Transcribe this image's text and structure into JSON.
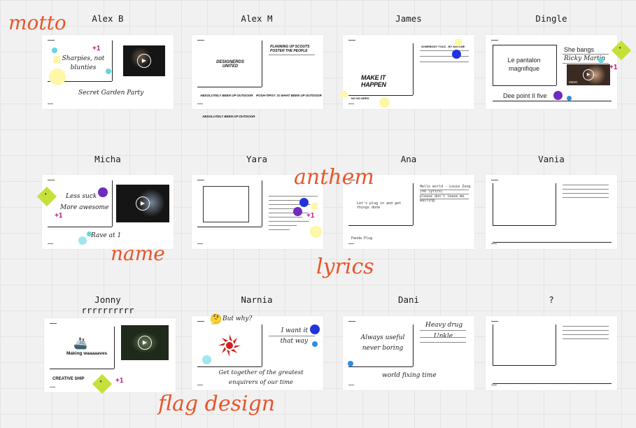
{
  "names": [
    "Alex B",
    "Alex M",
    "James",
    "Dingle",
    "Micha",
    "Yara",
    "Ana",
    "Vania",
    "Jonny",
    "Narnia",
    "Dani",
    "?"
  ],
  "jonny_subtitle": "rrrrrrrrrr",
  "labels": {
    "motto": "motto",
    "anthem": "anthem",
    "name": "name",
    "lyrics": "lyrics",
    "flag": "flag design"
  },
  "plus_one": "+1",
  "cards": {
    "alexb": {
      "motto": "Sharpies, not blunties",
      "name": "Secret Garden Party"
    },
    "alexm": {
      "motto": "DESIGNERDS UNITED",
      "anthem": "PLANNING UP SCOUTS POSTER THE PEOPLE",
      "name1": "ABSOLUTELY BEEN UP OUTDOOR",
      "lyrics1": "POSH-TIPSY: IS WHAT BEEN UP OUTDOOR",
      "name2": "ABSOLUTELY BEEN UP OUTDOOR"
    },
    "james": {
      "motto": "MAKE IT HAPPEN",
      "anthem": "SOMEBODY TOLD - BY ANYONE",
      "name": "NO NO NEED"
    },
    "dingle": {
      "motto": "Le pantalon magnifique",
      "anthem1": "She bangs",
      "anthem2": "Ricky Martin",
      "name": "Dee point II five",
      "vevo": "vevo"
    },
    "micha": {
      "motto1": "Less suck",
      "motto2": "More awesome",
      "name": "Rave at 1"
    },
    "ana": {
      "motto": "Let's plug in and get things done",
      "anthem1": "Hello world - Louie Zong",
      "anthem2": "(no lyrics)",
      "anthem3": "please don't leave me waiting",
      "name": "Panda Plug"
    },
    "jonny": {
      "motto": "Making waaaaaves",
      "name": "CREATIVE SHIP"
    },
    "narnia": {
      "emoji": "🤔",
      "question": "But why?",
      "anthem": "I want it that way",
      "name": "Get together of the greatest enquirers of our time"
    },
    "dani": {
      "motto": "Always useful never boring",
      "anthem1": "Heavy drug",
      "anthem2": "Unkle",
      "name": "world fixing time"
    }
  },
  "colors": {
    "accent": "#e8552b",
    "sticky": "#fff7a8",
    "plus": "#b5177a",
    "badge": "#c6e03a",
    "purple": "#6f2bbf",
    "blue": "#2233dd",
    "cyan": "#66d4dd"
  }
}
